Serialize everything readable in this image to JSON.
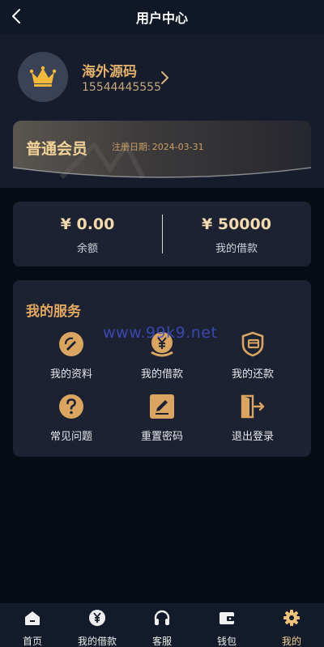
{
  "header": {
    "title": "用户中心",
    "back_icon": "chevron-left-icon"
  },
  "profile": {
    "name": "海外源码",
    "phone": "15544445555",
    "avatar_icon": "crown-icon"
  },
  "membership": {
    "level": "普通会员",
    "register_label": "注册日期:",
    "register_date": "2024-03-31"
  },
  "balance": {
    "available_value": "¥ 0.00",
    "available_label": "余额",
    "loan_value": "¥ 50000",
    "loan_label": "我的借款"
  },
  "services": {
    "title": "我的服务",
    "items": [
      {
        "label": "我的资料",
        "icon": "profile-edit-icon"
      },
      {
        "label": "我的借款",
        "icon": "loan-coin-icon"
      },
      {
        "label": "我的还款",
        "icon": "repayment-card-icon"
      },
      {
        "label": "常见问题",
        "icon": "question-icon"
      },
      {
        "label": "重置密码",
        "icon": "pencil-icon"
      },
      {
        "label": "退出登录",
        "icon": "logout-icon"
      }
    ]
  },
  "watermark": "www.99k9.net",
  "tabbar": {
    "items": [
      {
        "label": "首页",
        "icon": "home-icon"
      },
      {
        "label": "我的借款",
        "icon": "yen-icon"
      },
      {
        "label": "客服",
        "icon": "headset-icon"
      },
      {
        "label": "钱包",
        "icon": "wallet-icon"
      },
      {
        "label": "我的",
        "icon": "gear-icon"
      }
    ],
    "active": "我的"
  },
  "colors": {
    "accent_gold": "#e2b06b",
    "background": "#070b14",
    "card": "#1c2232"
  }
}
